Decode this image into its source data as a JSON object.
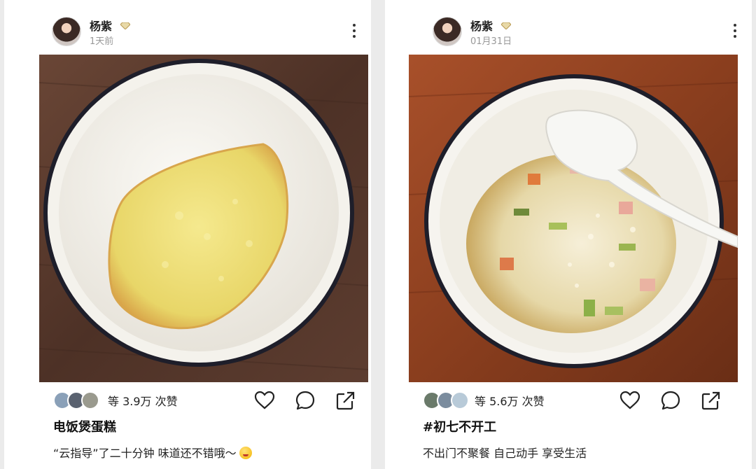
{
  "posts": [
    {
      "author": "杨紫",
      "time": "1天前",
      "likes": "等 3.9万 次赞",
      "title": "电饭煲蛋糕",
      "caption": "“云指导”了二十分钟 味道还不错哦～",
      "icons": {
        "more": "more-vertical-icon",
        "like": "heart-icon",
        "comment": "comment-bubble-icon",
        "share": "share-arrow-icon",
        "verified": "diamond-badge-icon"
      }
    },
    {
      "author": "杨紫",
      "time": "01月31日",
      "likes": "等 5.6万 次赞",
      "title": "#初七不开工",
      "caption": "不出门不聚餐 自己动手 享受生活",
      "icons": {
        "more": "more-vertical-icon",
        "like": "heart-icon",
        "comment": "comment-bubble-icon",
        "share": "share-arrow-icon",
        "verified": "diamond-badge-icon"
      }
    }
  ],
  "colors": {
    "table_wood": "#5a3a2c",
    "bowl": "#f4f2ec",
    "bowl_rim": "#1e1e2a",
    "cake": "#eedd78",
    "rice": "#efe6c8"
  }
}
